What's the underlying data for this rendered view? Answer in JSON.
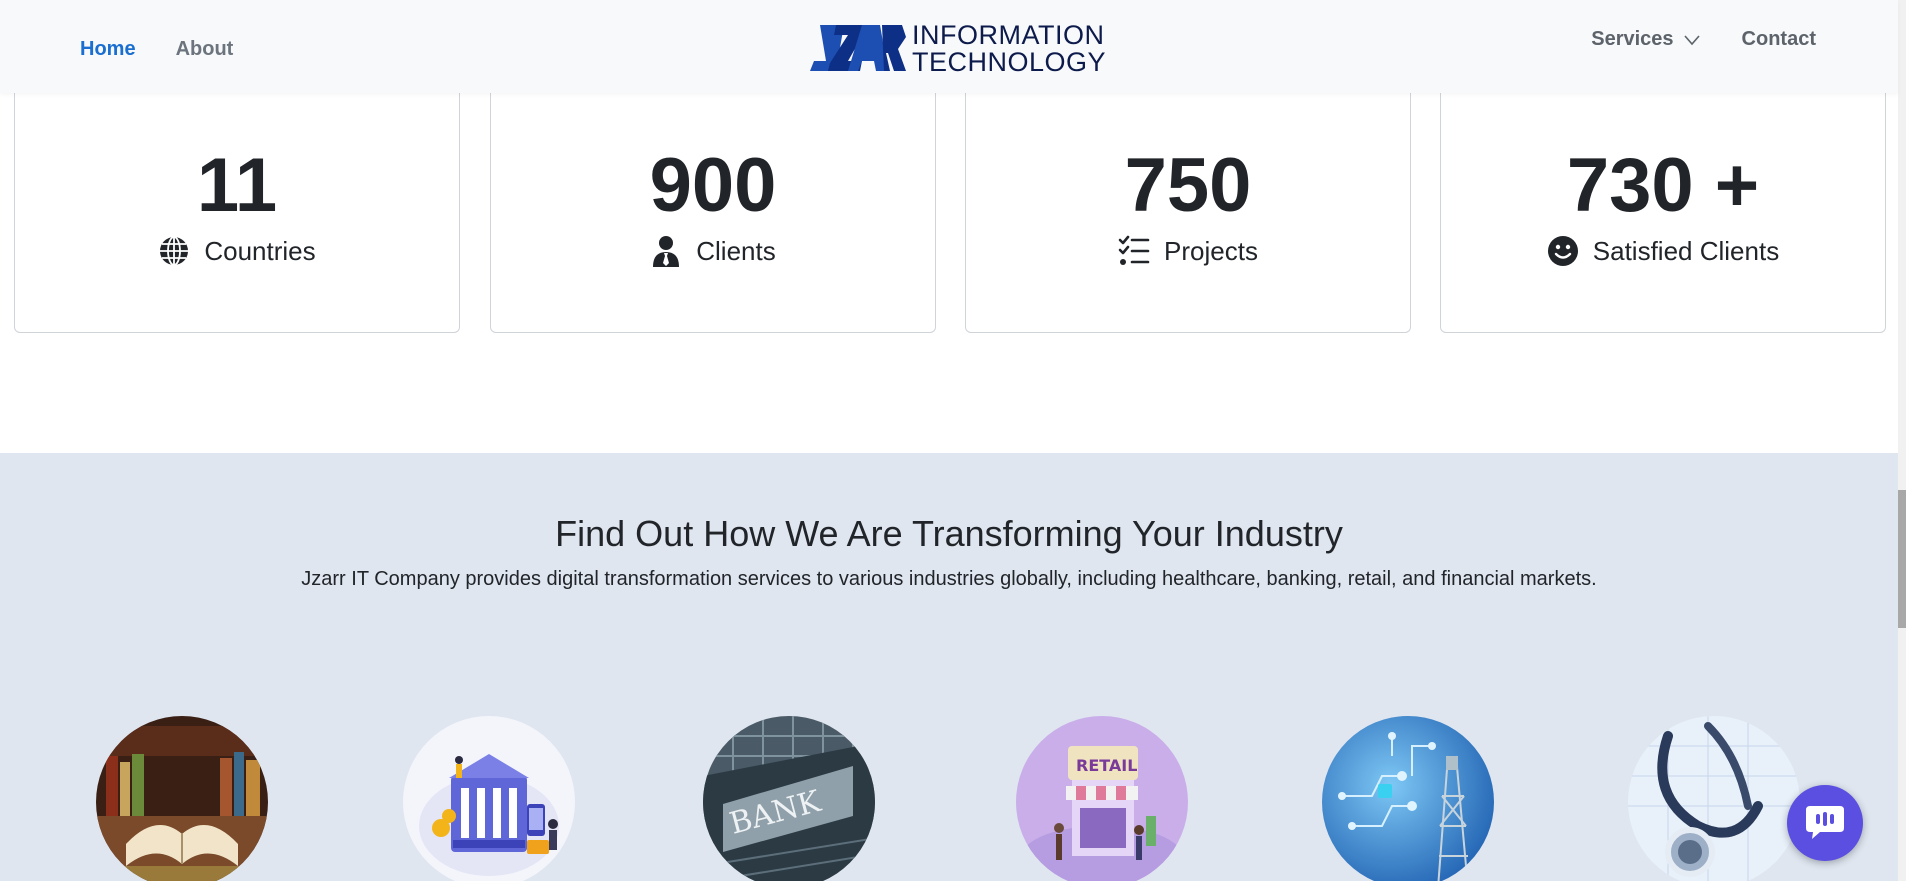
{
  "nav": {
    "home": "Home",
    "about": "About",
    "services": "Services",
    "contact": "Contact",
    "logo_line1": "INFORMATION",
    "logo_line2": "TECHNOLOGY"
  },
  "stats": [
    {
      "value": "11",
      "label": "Countries",
      "icon": "globe-icon"
    },
    {
      "value": "900",
      "label": "Clients",
      "icon": "user-tie-icon"
    },
    {
      "value": "750",
      "label": "Projects",
      "icon": "list-check-icon"
    },
    {
      "value": "730 +",
      "label": "Satisfied Clients",
      "icon": "smile-icon"
    }
  ],
  "industry": {
    "title": "Find Out How We Are Transforming Your Industry",
    "subtitle": "Jzarr IT Company provides digital transformation services to various industries globally, including healthcare, banking, retail, and financial markets.",
    "bank_sign": "BANK",
    "retail_sign": "RETAIL"
  },
  "colors": {
    "accent": "#1a6fd1",
    "section_bg": "#dfe6f0",
    "chat": "#5a4fe0"
  }
}
